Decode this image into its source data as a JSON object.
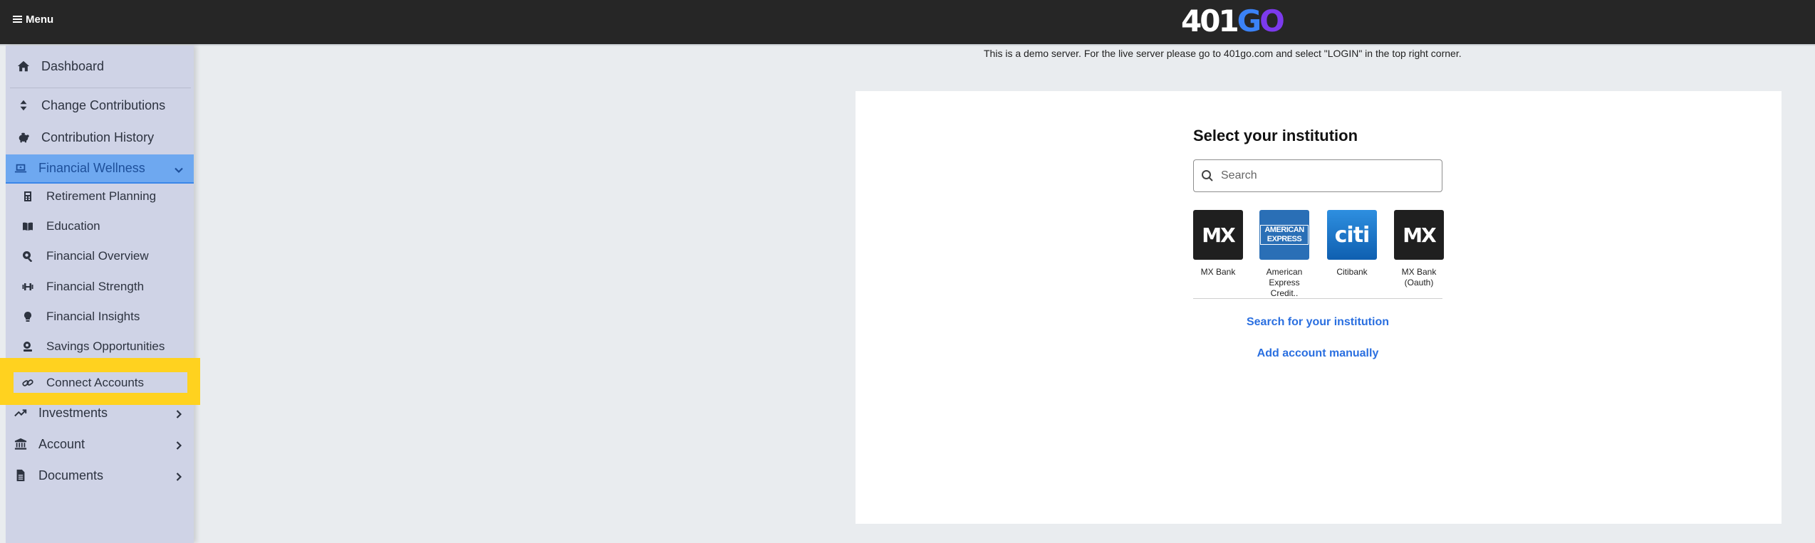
{
  "topbar": {
    "menu_label": "Menu",
    "logo": {
      "part1": "401",
      "part2": "G",
      "part3": "O"
    }
  },
  "sidebar": {
    "items": [
      {
        "label": "Dashboard",
        "icon": "home-icon"
      },
      {
        "label": "Change Contributions",
        "icon": "sort-icon"
      },
      {
        "label": "Contribution History",
        "icon": "piggy-bank-icon"
      },
      {
        "label": "Financial Wellness",
        "icon": "laptop-icon",
        "expanded": true,
        "active": true
      },
      {
        "label": "Retirement Planning",
        "icon": "calculator-icon"
      },
      {
        "label": "Education",
        "icon": "book-open-icon"
      },
      {
        "label": "Financial Overview",
        "icon": "search-dollar-icon"
      },
      {
        "label": "Financial Strength",
        "icon": "dumbbell-icon"
      },
      {
        "label": "Financial Insights",
        "icon": "lightbulb-icon"
      },
      {
        "label": "Savings Opportunities",
        "icon": "search-piggy-icon"
      },
      {
        "label": "Connect Accounts",
        "icon": "link-icon",
        "highlighted": true
      },
      {
        "label": "Investments",
        "icon": "trend-up-icon"
      },
      {
        "label": "Account",
        "icon": "bank-icon"
      },
      {
        "label": "Documents",
        "icon": "file-icon"
      }
    ]
  },
  "main": {
    "demo_note": "This is a demo server. For the live server please go to 401go.com and select \"LOGIN\" in the top right corner.",
    "title": "Select your institution",
    "search_placeholder": "Search",
    "institutions": [
      {
        "name": "MX Bank",
        "logo": "MX"
      },
      {
        "name": "American Express Credit..",
        "logo_line1": "AMERICAN",
        "logo_line2": "EXPRESS"
      },
      {
        "name": "Citibank",
        "logo": "citi"
      },
      {
        "name": "MX Bank (Oauth)",
        "logo": "MX"
      }
    ],
    "link_search": "Search for your institution",
    "link_manual": "Add account manually"
  },
  "colors": {
    "accent": "#6ea8f0",
    "highlight": "#ffd21f",
    "link": "#2a6fe0",
    "topbar": "#262626"
  }
}
